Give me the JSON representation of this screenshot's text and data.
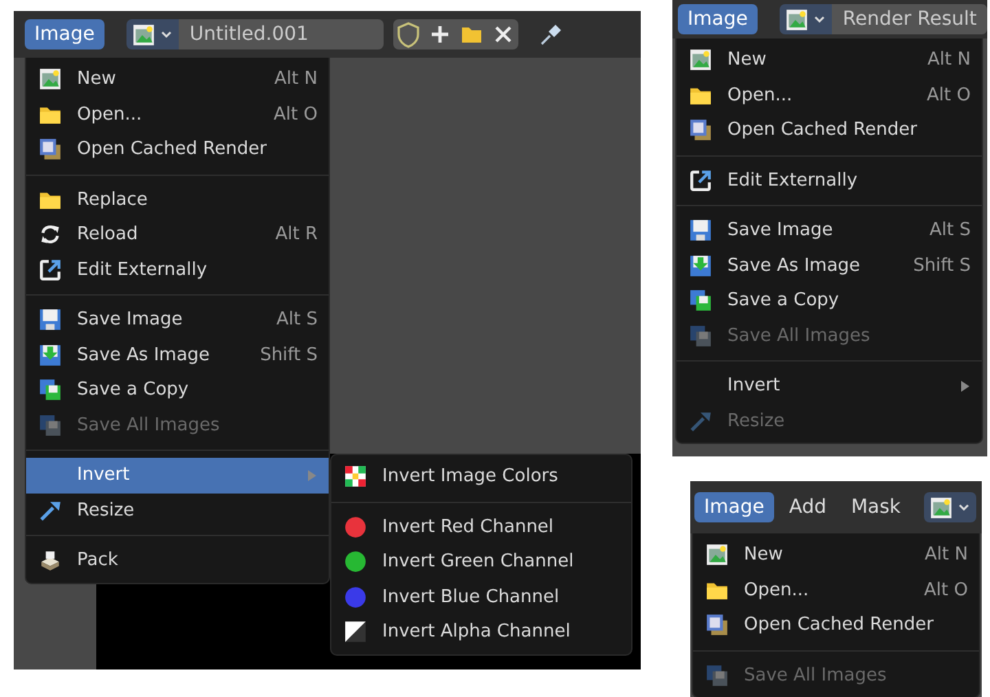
{
  "panels": [
    {
      "header": {
        "menus": [
          {
            "label": "Image",
            "selected": true
          }
        ],
        "image_name": "Untitled.001",
        "datablock_tools": true
      },
      "menu": {
        "sections": [
          {
            "items": [
              {
                "label": "New",
                "shortcut": "Alt N",
                "kind": "new",
                "selected": false,
                "disabled": false
              },
              {
                "label": "Open...",
                "shortcut": "Alt O",
                "kind": "open",
                "selected": false,
                "disabled": false
              },
              {
                "label": "Open Cached Render",
                "kind": "cached",
                "selected": false,
                "disabled": false
              }
            ]
          },
          {
            "items": [
              {
                "label": "Replace",
                "kind": "open",
                "selected": false,
                "disabled": false
              },
              {
                "label": "Reload",
                "shortcut": "Alt R",
                "kind": "reload",
                "selected": false,
                "disabled": false
              },
              {
                "label": "Edit Externally",
                "kind": "external",
                "selected": false,
                "disabled": false
              }
            ]
          },
          {
            "items": [
              {
                "label": "Save Image",
                "shortcut": "Alt S",
                "kind": "save",
                "selected": false,
                "disabled": false
              },
              {
                "label": "Save As Image",
                "shortcut": "Shift S",
                "kind": "save-as",
                "selected": false,
                "disabled": false
              },
              {
                "label": "Save a Copy",
                "kind": "save-copy",
                "selected": false,
                "disabled": false
              },
              {
                "label": "Save All Images",
                "kind": "save-all",
                "selected": false,
                "disabled": true
              }
            ]
          },
          {
            "items": [
              {
                "label": "Invert",
                "kind": "plain",
                "submenu": true,
                "selected": true,
                "disabled": false
              },
              {
                "label": "Resize",
                "kind": "resize",
                "selected": false,
                "disabled": false
              }
            ]
          },
          {
            "items": [
              {
                "label": "Pack",
                "kind": "pack",
                "selected": false,
                "disabled": false
              }
            ]
          }
        ]
      },
      "submenu": {
        "sections": [
          {
            "items": [
              {
                "label": "Invert Image Colors",
                "kind": "checker",
                "selected": false
              }
            ]
          },
          {
            "items": [
              {
                "label": "Invert Red Channel",
                "kind": "channel",
                "color": "#e8333c",
                "selected": false
              },
              {
                "label": "Invert Green Channel",
                "kind": "channel",
                "color": "#27b833",
                "selected": false
              },
              {
                "label": "Invert Blue Channel",
                "kind": "channel",
                "color": "#3a3ae8",
                "selected": false
              },
              {
                "label": "Invert Alpha Channel",
                "kind": "alpha",
                "selected": false
              }
            ]
          }
        ]
      }
    },
    {
      "header": {
        "menus": [
          {
            "label": "Image",
            "selected": true
          }
        ],
        "image_name": "Render Result"
      },
      "menu": {
        "sections": [
          {
            "items": [
              {
                "label": "New",
                "shortcut": "Alt N",
                "kind": "new",
                "selected": false,
                "disabled": false
              },
              {
                "label": "Open...",
                "shortcut": "Alt O",
                "kind": "open",
                "selected": false,
                "disabled": false
              },
              {
                "label": "Open Cached Render",
                "kind": "cached",
                "selected": false,
                "disabled": false
              }
            ]
          },
          {
            "items": [
              {
                "label": "Edit Externally",
                "kind": "external",
                "selected": false,
                "disabled": false
              }
            ]
          },
          {
            "items": [
              {
                "label": "Save Image",
                "shortcut": "Alt S",
                "kind": "save",
                "selected": false,
                "disabled": false
              },
              {
                "label": "Save As Image",
                "shortcut": "Shift S",
                "kind": "save-as",
                "selected": false,
                "disabled": false
              },
              {
                "label": "Save a Copy",
                "kind": "save-copy",
                "selected": false,
                "disabled": false
              },
              {
                "label": "Save All Images",
                "kind": "save-all",
                "selected": false,
                "disabled": true
              }
            ]
          },
          {
            "items": [
              {
                "label": "Invert",
                "kind": "plain",
                "submenu": true,
                "selected": false,
                "disabled": false
              },
              {
                "label": "Resize",
                "kind": "resize",
                "selected": false,
                "disabled": true
              }
            ]
          }
        ]
      }
    },
    {
      "header": {
        "menus": [
          {
            "label": "Image",
            "selected": true
          },
          {
            "label": "Add",
            "selected": false
          },
          {
            "label": "Mask",
            "selected": false
          }
        ]
      },
      "menu": {
        "sections": [
          {
            "items": [
              {
                "label": "New",
                "shortcut": "Alt N",
                "kind": "new",
                "selected": false,
                "disabled": false
              },
              {
                "label": "Open...",
                "shortcut": "Alt O",
                "kind": "open",
                "selected": false,
                "disabled": false
              },
              {
                "label": "Open Cached Render",
                "kind": "cached",
                "selected": false,
                "disabled": false
              }
            ]
          },
          {
            "items": [
              {
                "label": "Save All Images",
                "kind": "save-all",
                "selected": false,
                "disabled": true
              }
            ]
          }
        ]
      }
    }
  ]
}
